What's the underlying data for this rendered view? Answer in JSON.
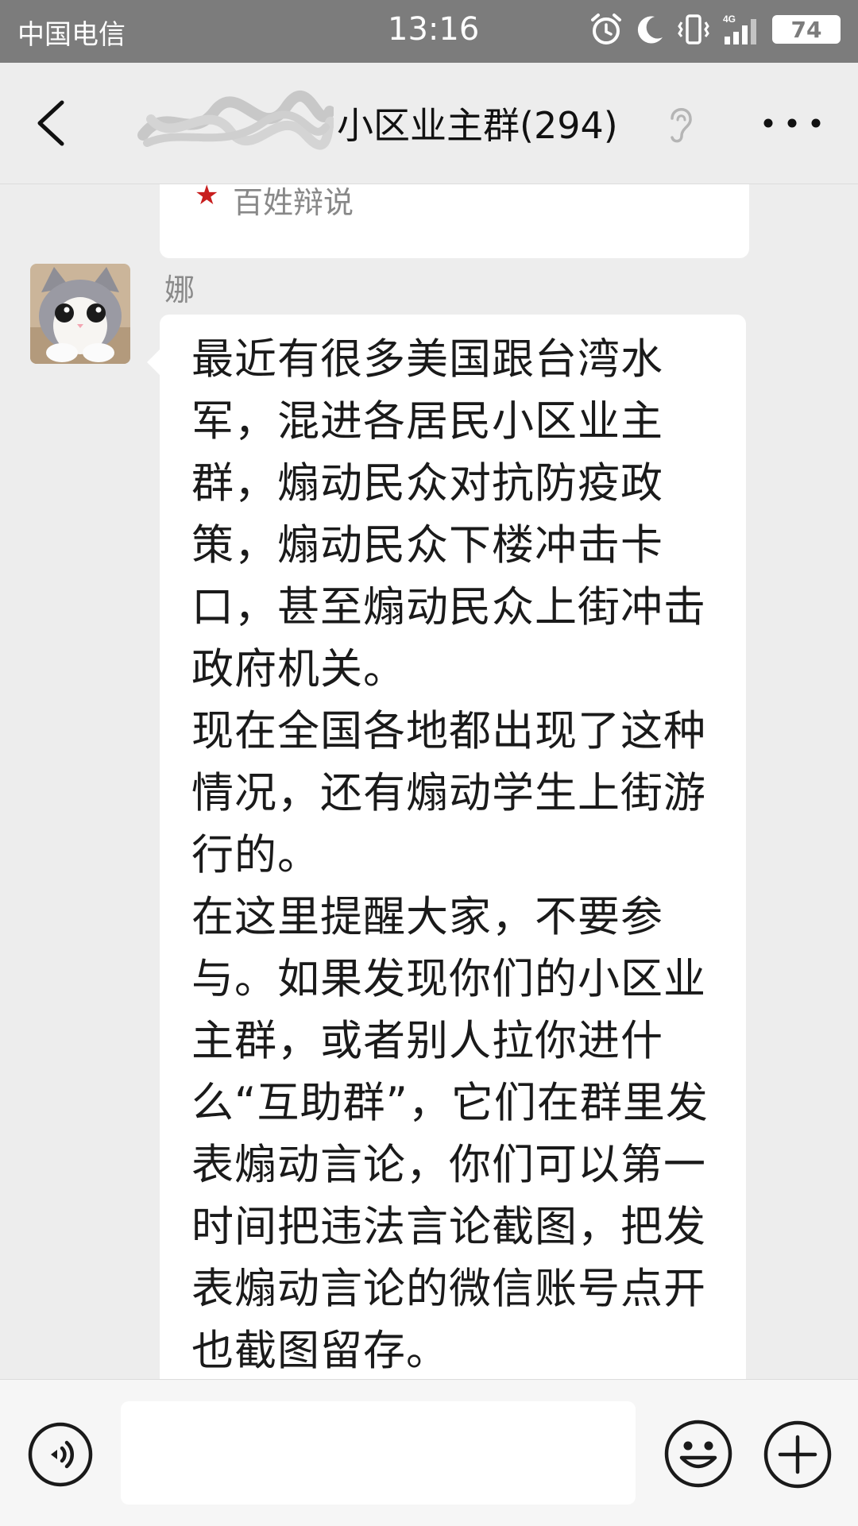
{
  "status_bar": {
    "carrier": "中国电信",
    "time": "13:16",
    "network": "4G",
    "battery": "74"
  },
  "header": {
    "title": "小区业主群(294)"
  },
  "previous_message": {
    "source_label": "百姓辩说",
    "star": "★"
  },
  "message": {
    "sender": "娜",
    "text": "最近有很多美国跟台湾水军，混进各居民小区业主群，煽动民众对抗防疫政策，煽动民众下楼冲击卡口，甚至煽动民众上街冲击政府机关。\n现在全国各地都出现了这种情况，还有煽动学生上街游行的。\n在这里提醒大家，不要参与。如果发现你们的小区业主群，或者别人拉你进什么“互助群”，它们在群里发表煽动言论，你们可以第一时间把违法言论截图，把发表煽动言论的微信账号点开也截图留存。"
  },
  "input_bar": {
    "placeholder": ""
  },
  "colors": {
    "status_bar_bg": "#7c7c7c",
    "page_bg": "#ededed",
    "bubble_bg": "#ffffff",
    "star": "#c81e1e"
  },
  "icons": {
    "back": "back-arrow-icon",
    "listen": "ear-icon",
    "more": "more-dots-icon",
    "voice": "voice-icon",
    "emoji": "smiley-icon",
    "plus": "plus-icon",
    "alarm": "alarm-icon",
    "moon": "moon-icon",
    "vibrate": "vibrate-icon",
    "signal": "signal-icon",
    "battery": "battery-icon"
  }
}
